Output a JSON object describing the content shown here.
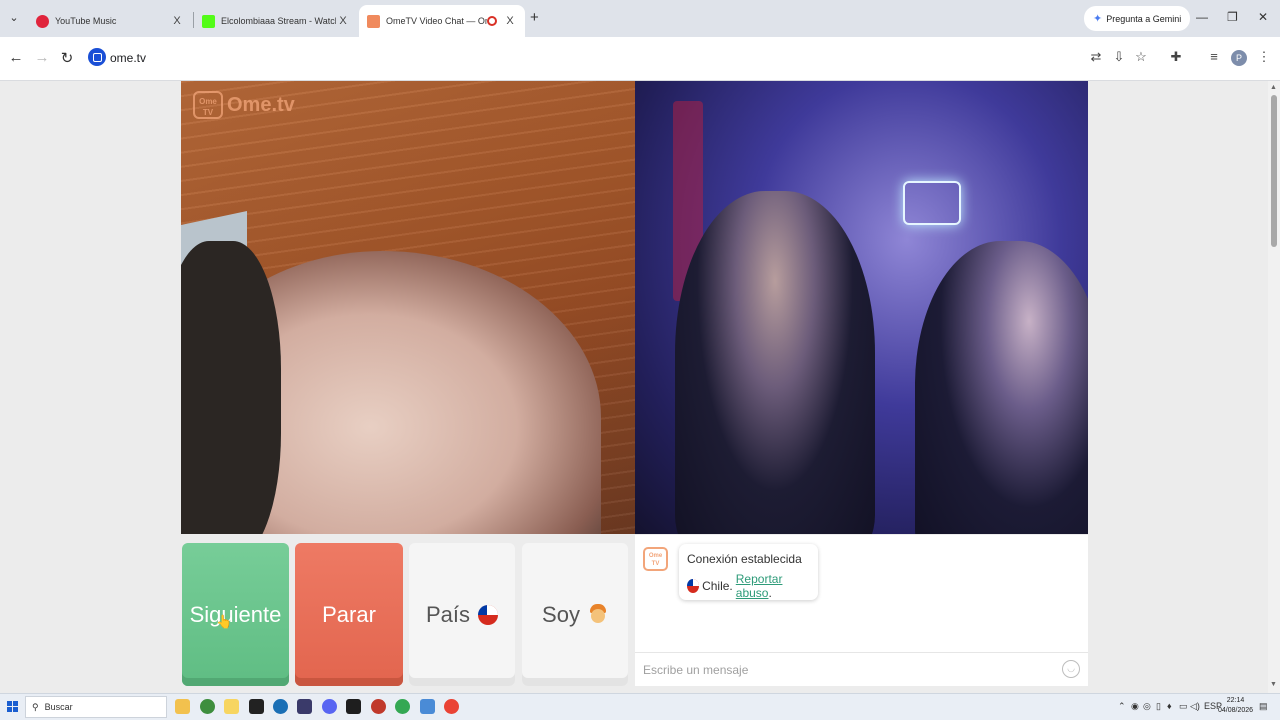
{
  "browser": {
    "tabs": [
      {
        "title": "YouTube Music",
        "favicon_color": "#e0243c",
        "active": false
      },
      {
        "title": "Elcolombiaaa Stream - Watch Live on Kick",
        "favicon_color": "#53fc18",
        "active": false
      },
      {
        "title": "OmeTV Video Chat — Omegle Random",
        "favicon_color": "#f08a5d",
        "active": true
      }
    ],
    "close_glyph": "X",
    "new_tab_glyph": "+",
    "gemini_label": "Pregunta a Gemini",
    "url": "ome.tv",
    "profile_initial": "P"
  },
  "app": {
    "logo_text": "Ome.tv",
    "logo_badge": "Ome TV",
    "buttons": {
      "next": "Siguiente",
      "stop": "Parar",
      "country": "País",
      "gender": "Soy"
    },
    "chat": {
      "status_line": "Conexión establecida",
      "country": "Chile.",
      "report_link": "Reportar abuso",
      "report_suffix": ".",
      "input_placeholder": "Escribe un mensaje"
    }
  },
  "taskbar": {
    "search_label": "Buscar",
    "language": "ESP",
    "time": "22:14",
    "date": "04/08/2026"
  },
  "colors": {
    "next_button": "#6cc58f",
    "stop_button": "#e8705a",
    "link": "#2e9b79",
    "brand": "#f2a57a"
  }
}
